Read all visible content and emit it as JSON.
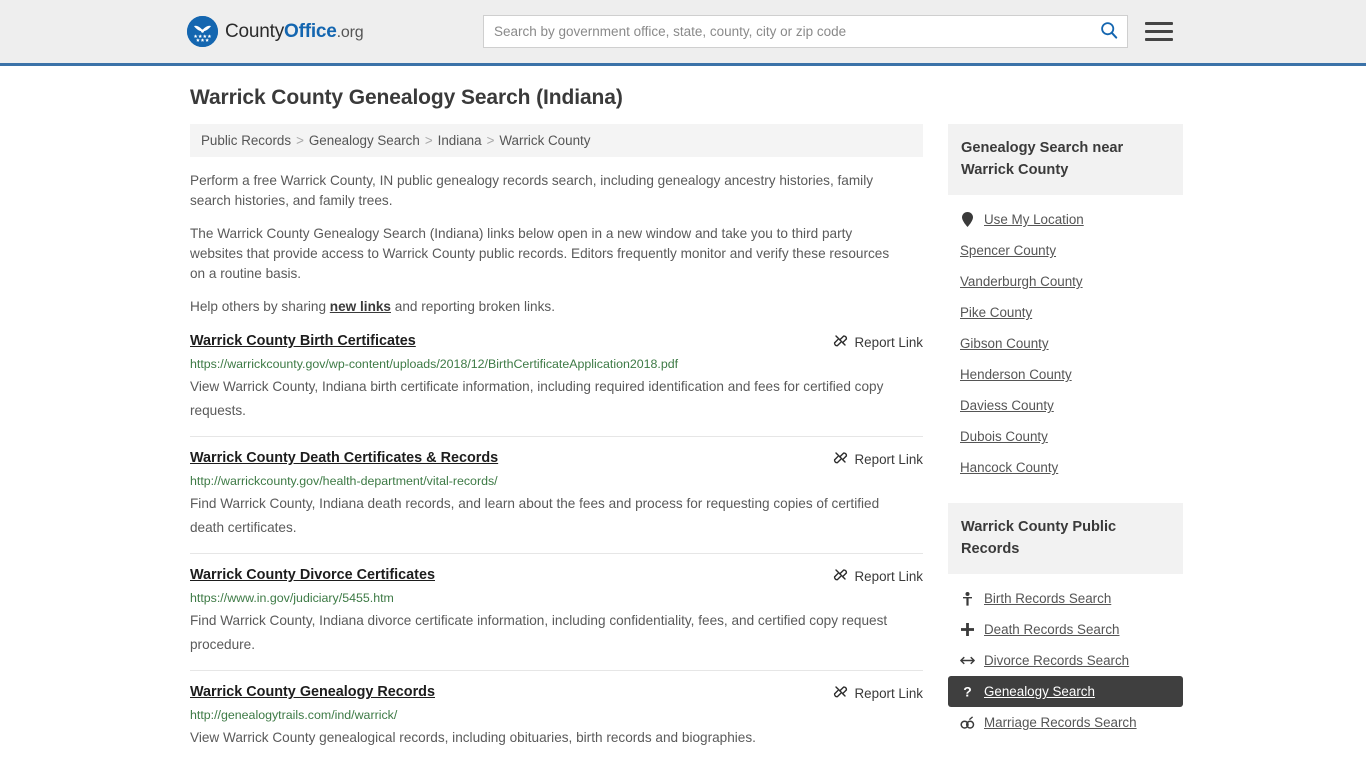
{
  "header": {
    "brand": {
      "county": "County",
      "office": "Office",
      "org": ".org",
      "logo_icon": "eagle-shield-icon"
    },
    "search": {
      "placeholder": "Search by government office, state, county, city or zip code",
      "value": "",
      "search_icon": "search-icon"
    },
    "menu_icon": "hamburger-menu-icon"
  },
  "page": {
    "title": "Warrick County Genealogy Search (Indiana)",
    "breadcrumb": {
      "separator": ">",
      "items": [
        "Public Records",
        "Genealogy Search",
        "Indiana",
        "Warrick County"
      ]
    },
    "intro": {
      "p1": "Perform a free Warrick County, IN public genealogy records search, including genealogy ancestry histories, family search histories, and family trees.",
      "p2": "The Warrick County Genealogy Search (Indiana) links below open in a new window and take you to third party websites that provide access to Warrick County public records. Editors frequently monitor and verify these resources on a routine basis.",
      "p3_before": "Help others by sharing ",
      "p3_link": "new links",
      "p3_after": " and reporting broken links."
    },
    "report_link_label": "Report Link",
    "report_link_icon": "broken-link-icon",
    "results": [
      {
        "title": "Warrick County Birth Certificates",
        "url": "https://warrickcounty.gov/wp-content/uploads/2018/12/BirthCertificateApplication2018.pdf",
        "description": "View Warrick County, Indiana birth certificate information, including required identification and fees for certified copy requests."
      },
      {
        "title": "Warrick County Death Certificates & Records",
        "url": "http://warrickcounty.gov/health-department/vital-records/",
        "description": "Find Warrick County, Indiana death records, and learn about the fees and process for requesting copies of certified death certificates."
      },
      {
        "title": "Warrick County Divorce Certificates",
        "url": "https://www.in.gov/judiciary/5455.htm",
        "description": "Find Warrick County, Indiana divorce certificate information, including confidentiality, fees, and certified copy request procedure."
      },
      {
        "title": "Warrick County Genealogy Records",
        "url": "http://genealogytrails.com/ind/warrick/",
        "description": "View Warrick County genealogical records, including obituaries, birth records and biographies."
      }
    ]
  },
  "sidebar": {
    "nearby": {
      "heading": "Genealogy Search near Warrick County",
      "items": [
        {
          "label": "Use My Location",
          "icon": "map-pin-icon",
          "has_icon": true
        },
        {
          "label": "Spencer County",
          "icon": "",
          "has_icon": false
        },
        {
          "label": "Vanderburgh County",
          "icon": "",
          "has_icon": false
        },
        {
          "label": "Pike County",
          "icon": "",
          "has_icon": false
        },
        {
          "label": "Gibson County",
          "icon": "",
          "has_icon": false
        },
        {
          "label": "Henderson County",
          "icon": "",
          "has_icon": false
        },
        {
          "label": "Daviess County",
          "icon": "",
          "has_icon": false
        },
        {
          "label": "Dubois County",
          "icon": "",
          "has_icon": false
        },
        {
          "label": "Hancock County",
          "icon": "",
          "has_icon": false
        }
      ]
    },
    "public_records": {
      "heading": "Warrick County Public Records",
      "items": [
        {
          "label": "Birth Records Search",
          "icon": "baby-icon",
          "active": false
        },
        {
          "label": "Death Records Search",
          "icon": "cross-icon",
          "active": false
        },
        {
          "label": "Divorce Records Search",
          "icon": "split-arrows-icon",
          "active": false
        },
        {
          "label": "Genealogy Search",
          "icon": "question-mark-icon",
          "active": true
        },
        {
          "label": "Marriage Records Search",
          "icon": "rings-icon",
          "active": false
        }
      ]
    }
  },
  "colors": {
    "brand_blue": "#1466b0",
    "header_bg": "#eeeeee",
    "header_border": "#3b72a8",
    "url_green": "#3d7a45",
    "active_bg": "#3f3f3f",
    "panel_bg": "#f2f2f2"
  }
}
